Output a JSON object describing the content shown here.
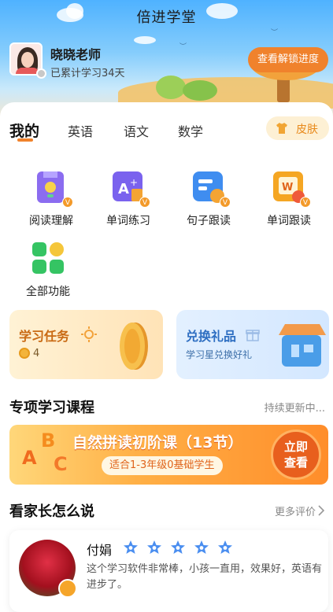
{
  "header": {
    "app_title": "倍进学堂",
    "teacher_name": "晓晓老师",
    "study_days": "已累计学习34天",
    "unlock_button": "查看解锁进度"
  },
  "tabs": [
    {
      "label": "我的",
      "active": true
    },
    {
      "label": "英语",
      "active": false
    },
    {
      "label": "语文",
      "active": false
    },
    {
      "label": "数学",
      "active": false
    }
  ],
  "skin_button": "皮肤",
  "features": [
    {
      "label": "阅读理解",
      "icon": "book-icon",
      "color": "#8b6cf0",
      "vip": true
    },
    {
      "label": "单词练习",
      "icon": "word-practice-icon",
      "color": "#7a62ee",
      "vip": true
    },
    {
      "label": "句子跟读",
      "icon": "sentence-icon",
      "color": "#3f8df0",
      "vip": true
    },
    {
      "label": "单词跟读",
      "icon": "word-read-icon",
      "color": "#f5a623",
      "vip": true
    },
    {
      "label": "全部功能",
      "icon": "grid-icon",
      "color": "#35c463",
      "vip": false
    }
  ],
  "task_card": {
    "title": "学习任务",
    "count": "4"
  },
  "gift_card": {
    "title": "兑换礼品",
    "subtitle": "学习星兑换好礼"
  },
  "course_section": {
    "title": "专项学习课程",
    "more": "持续更新中..."
  },
  "banner": {
    "title": "自然拼读初阶课（13节）",
    "subtitle": "适合1-3年级0基础学生",
    "button_line1": "立即",
    "button_line2": "查看"
  },
  "review_section": {
    "title": "看家长怎么说",
    "more": "更多评价"
  },
  "review": {
    "name": "付娟",
    "stars": 5,
    "text": "这个学习软件非常棒，小孩一直用，效果好，英语有进步了。"
  },
  "colors": {
    "accent": "#f0822c",
    "star": "#4a8ef0"
  }
}
